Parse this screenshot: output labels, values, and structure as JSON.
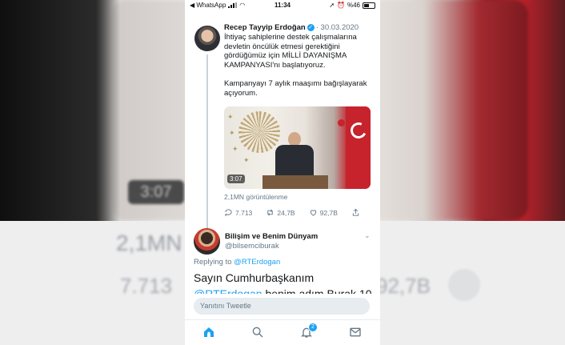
{
  "status_bar": {
    "back_app": "◀ WhatsApp",
    "time": "11:34",
    "battery": "%46"
  },
  "tweet": {
    "author_name": "Recep Tayyip Erdoğan",
    "date": "30.03.2020",
    "text": "İhtiyaç sahiplerine destek çalışmalarına devletin öncülük etmesi gerektiğini gördüğümüz için MİLLİ DAYANIŞMA KAMPANYASI'nı başlatıyoruz.\n\nKampanyayı 7 aylık maaşımı bağışlayarak açıyorum.",
    "video_duration": "3:07",
    "views": "2,1MN görüntülenme",
    "replies": "7.713",
    "retweets": "24,7B",
    "likes": "92,7B"
  },
  "reply": {
    "author_name": "Bilişim ve Benim Dünyam",
    "handle": "@bilsemciburak",
    "replying_prefix": "Replying to",
    "replying_to": "@RTErdogan",
    "text": "Sayın Cumhurbaşkanım",
    "text_mention": "@RTErdogan",
    "text_continued": " benim adım Burak 10"
  },
  "compose": {
    "placeholder": "Yanıtını Tweetle"
  },
  "tab_bar": {
    "notification_count": "2"
  },
  "background": {
    "blur_duration": "3:07",
    "blur_views": "2,1MN g",
    "blur_replies": "7.713",
    "blur_likes": "92,7B"
  },
  "colors": {
    "accent": "#1da1f2",
    "flag_red": "#c6232d"
  }
}
